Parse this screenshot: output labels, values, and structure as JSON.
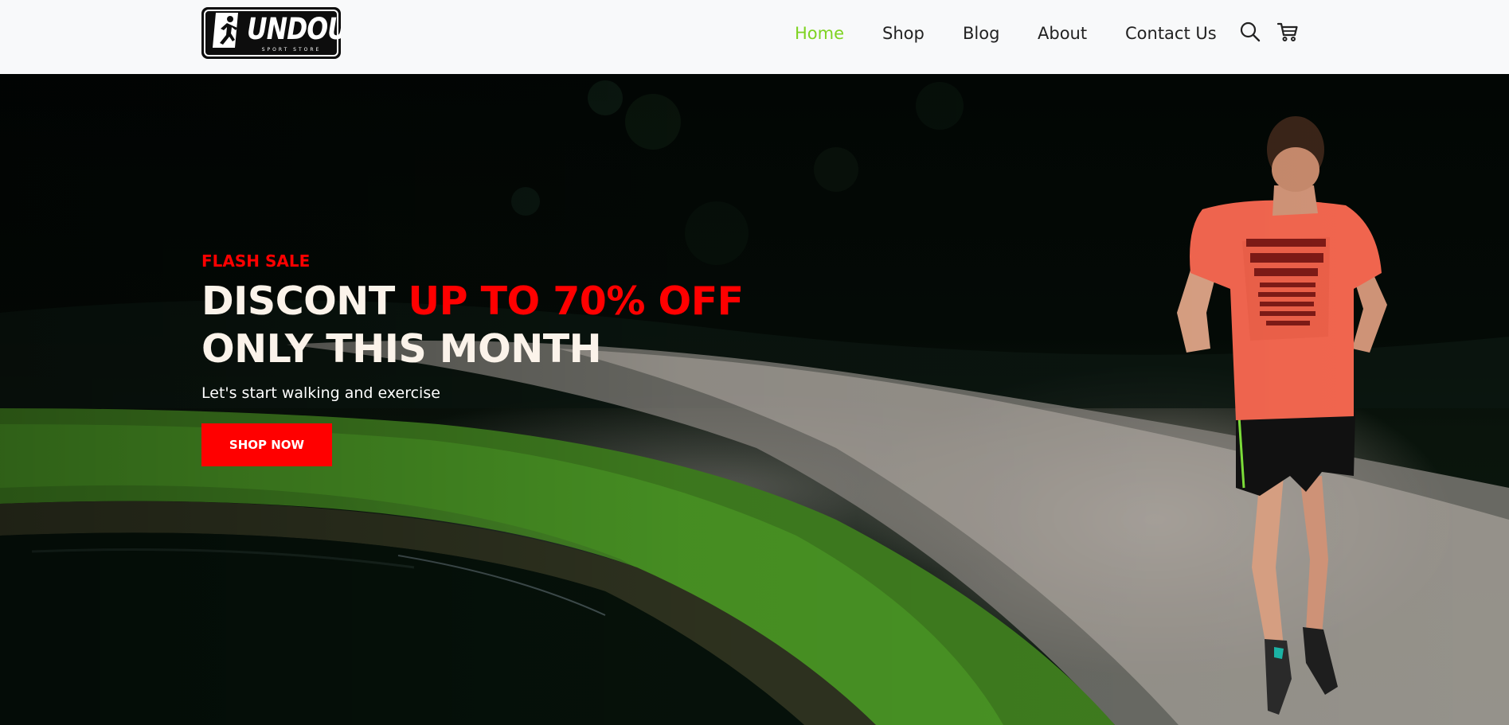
{
  "brand": {
    "logo_text": "UNDOU",
    "logo_tagline": "SPORT STORE"
  },
  "nav": {
    "items": [
      {
        "label": "Home",
        "active": true
      },
      {
        "label": "Shop",
        "active": false
      },
      {
        "label": "Blog",
        "active": false
      },
      {
        "label": "About",
        "active": false
      },
      {
        "label": "Contact Us",
        "active": false
      }
    ],
    "icons": [
      "search-icon",
      "cart-icon"
    ]
  },
  "hero": {
    "eyebrow": "FLASH SALE",
    "headline_part1": "DISCONT ",
    "headline_highlight": "UP TO 70% OFF",
    "headline_line2": "ONLY THIS MONTH",
    "subtitle": "Let's start walking and exercise",
    "cta_label": "SHOP NOW"
  },
  "colors": {
    "accent_red": "#ff0000",
    "nav_active": "#7ed321",
    "header_bg": "#f8f9fa"
  }
}
